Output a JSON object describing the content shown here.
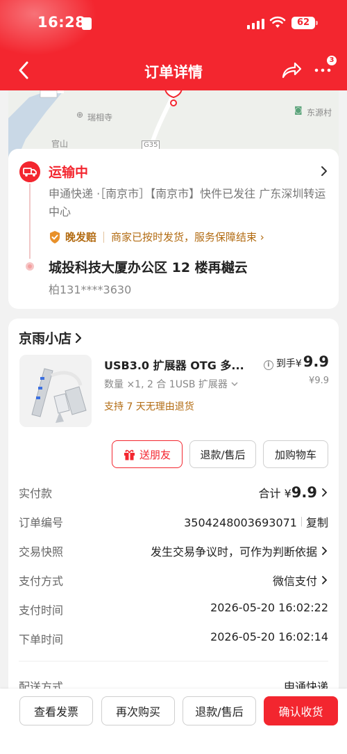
{
  "status_bar": {
    "time": "16:28",
    "battery": "62"
  },
  "nav": {
    "title": "订单详情",
    "more_badge": "3"
  },
  "map": {
    "labels": [
      "瑞相寺",
      "官山",
      "G35",
      "东源村"
    ]
  },
  "shipping": {
    "status": "运输中",
    "detail": "申通快递 ·［南京市］【南京市】快件已发往 广东深圳转运中心",
    "guarantee_name": "晚发赔",
    "guarantee_desc": "商家已按时发货，服务保障结束 ›",
    "address": "城投科技大厦办公区 12 楼再樾云",
    "phone": "柏131****3630"
  },
  "shop": {
    "name": "京雨小店"
  },
  "product": {
    "title": "USB3.0 扩展器 OTG 多...",
    "spec": "数量 ×1, 2 合 1USB 扩展器",
    "return_policy": "支持 7 天无理由退货",
    "final_prefix": "到手",
    "final_currency": "¥",
    "final_price": "9.9",
    "original_price": "¥9.9"
  },
  "actions": {
    "gift": "送朋友",
    "refund": "退款/售后",
    "add_cart": "加购物车"
  },
  "details": {
    "paid_label": "实付款",
    "paid_prefix": "合计 ¥",
    "paid_value": "9.9",
    "order_no_label": "订单编号",
    "order_no": "3504248003693071",
    "copy": "复制",
    "snapshot_label": "交易快照",
    "snapshot_value": "发生交易争议时，可作为判断依据",
    "pay_method_label": "支付方式",
    "pay_method": "微信支付",
    "pay_time_label": "支付时间",
    "pay_time": "2026-05-20 16:02:22",
    "order_time_label": "下单时间",
    "order_time": "2026-05-20 16:02:14",
    "delivery_label": "配送方式",
    "delivery": "申通快递"
  },
  "bottom": {
    "invoice": "查看发票",
    "rebuy": "再次购买",
    "refund": "退款/售后",
    "confirm": "确认收货"
  },
  "colors": {
    "brand_red": "#f3262f",
    "gold": "#b26b12"
  }
}
